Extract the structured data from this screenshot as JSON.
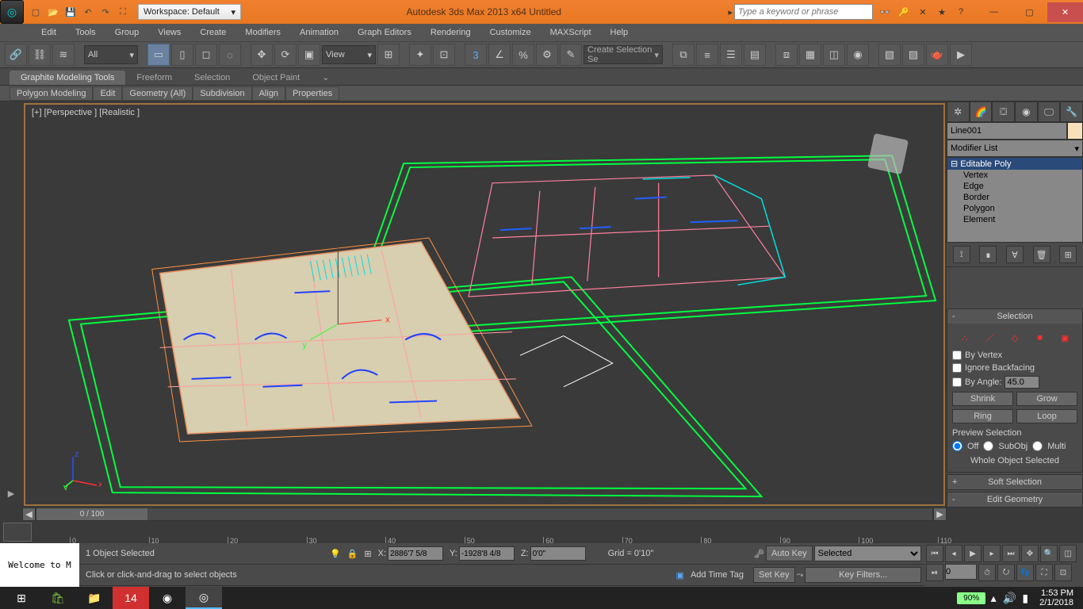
{
  "titlebar": {
    "workspace": "Workspace: Default",
    "title": "Autodesk 3ds Max  2013 x64      Untitled",
    "search_placeholder": "Type a keyword or phrase"
  },
  "menus": [
    "Edit",
    "Tools",
    "Group",
    "Views",
    "Create",
    "Modifiers",
    "Animation",
    "Graph Editors",
    "Rendering",
    "Customize",
    "MAXScript",
    "Help"
  ],
  "toolbar": {
    "all": "All",
    "view": "View",
    "selset": "Create Selection Se"
  },
  "ribbon": {
    "tabs": [
      "Graphite Modeling Tools",
      "Freeform",
      "Selection",
      "Object Paint"
    ],
    "subs": [
      "Polygon Modeling",
      "Edit",
      "Geometry (All)",
      "Subdivision",
      "Align",
      "Properties"
    ]
  },
  "viewport": {
    "label": "[+] [Perspective ] [Realistic ]",
    "axis_x": "x",
    "axis_y": "y",
    "axis_z": "z"
  },
  "cmd": {
    "obj_name": "Line001",
    "mod_list": "Modifier List",
    "stack_top": "Editable Poly",
    "subs": [
      "Vertex",
      "Edge",
      "Border",
      "Polygon",
      "Element"
    ],
    "selection_head": "Selection",
    "by_vertex": "By Vertex",
    "ignore_bf": "Ignore Backfacing",
    "by_angle": "By Angle:",
    "angle": "45.0",
    "shrink": "Shrink",
    "grow": "Grow",
    "ring": "Ring",
    "loop": "Loop",
    "preview": "Preview Selection",
    "off": "Off",
    "subobj": "SubObj",
    "multi": "Multi",
    "whole": "Whole Object Selected",
    "soft": "Soft Selection",
    "editgeo": "Edit Geometry"
  },
  "time": {
    "range": "0 / 100",
    "ticks": [
      0,
      10,
      20,
      30,
      40,
      50,
      60,
      70,
      80,
      90,
      100,
      110
    ]
  },
  "status": {
    "welcome": "Welcome to M",
    "row1": "1 Object Selected",
    "row2": "Click or click-and-drag to select objects",
    "x": "2886'7 5/8",
    "y": "-1928'8 4/8",
    "z": "0'0\"",
    "grid": "Grid = 0'10\"",
    "addtag": "Add Time Tag",
    "autokey": "Auto Key",
    "setkey": "Set Key",
    "selected": "Selected",
    "keyfilters": "Key Filters...",
    "frame": "0"
  },
  "taskbar": {
    "battery": "90%",
    "time": "1:53 PM",
    "date": "2/1/2018"
  }
}
